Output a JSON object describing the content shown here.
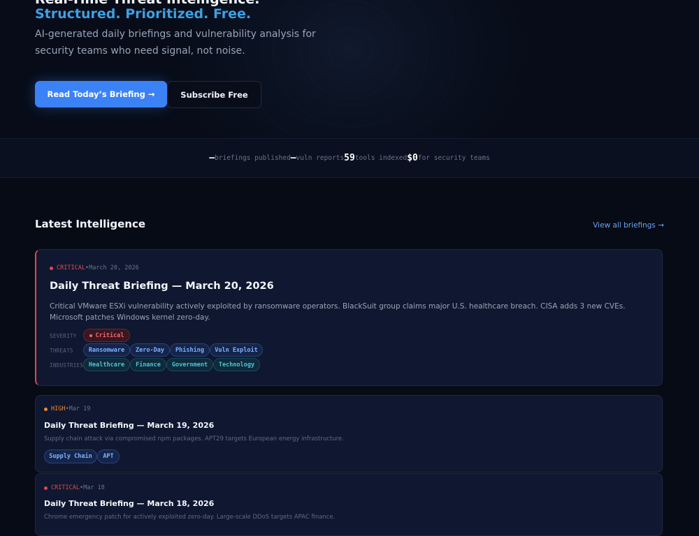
{
  "hero": {
    "title": "Real-Time Threat Intelligence.",
    "subtitle": "Structured. Prioritized. Free.",
    "description": "AI-generated daily briefings and vulnerability analysis for security teams who need signal, not noise.",
    "primary_button": "Read Today’s Briefing →",
    "secondary_button": "Subscribe Free"
  },
  "stats": [
    {
      "value": "—",
      "label": "briefings published"
    },
    {
      "value": "—",
      "label": "vuln reports"
    },
    {
      "value": "59",
      "label": "tools indexed"
    },
    {
      "value": "$0",
      "label": "for security teams"
    }
  ],
  "latest": {
    "title": "Latest Intelligence",
    "view_all": "View all briefings →"
  },
  "featured": {
    "severity": "CRITICAL",
    "separator": "•",
    "date": "March 20, 2026",
    "title": "Daily Threat Briefing — March 20, 2026",
    "summary": "Critical VMware ESXi vulnerability actively exploited by ransomware operators. BlackSuit group claims major U.S. healthcare breach. CISA adds 3 new CVEs. Microsoft patches Windows kernel zero-day.",
    "labels": {
      "severity": "SEVERITY",
      "threats": "THREATS",
      "industries": "INDUSTRIES"
    },
    "severity_tag": "Critical",
    "threats": [
      "Ransomware",
      "Zero-Day",
      "Phishing",
      "Vuln Exploit"
    ],
    "industries": [
      "Healthcare",
      "Finance",
      "Government",
      "Technology"
    ]
  },
  "briefings": [
    {
      "severity": "HIGH",
      "separator": "•",
      "date": "Mar 19",
      "title": "Daily Threat Briefing — March 19, 2026",
      "summary": "Supply chain attack via compromised npm packages. APT29 targets European energy infrastructure.",
      "tags": [
        "Supply Chain",
        "APT"
      ]
    },
    {
      "severity": "CRITICAL",
      "separator": "•",
      "date": "Mar 18",
      "title": "Daily Threat Briefing — March 18, 2026",
      "summary": "Chrome emergency patch for actively exploited zero-day. Large-scale DDoS targets APAC finance."
    }
  ],
  "colors": {
    "accent": "#3b82f6",
    "critical": "#e5484d",
    "high": "#f5862f",
    "subtitle": "#3ea0e4"
  }
}
